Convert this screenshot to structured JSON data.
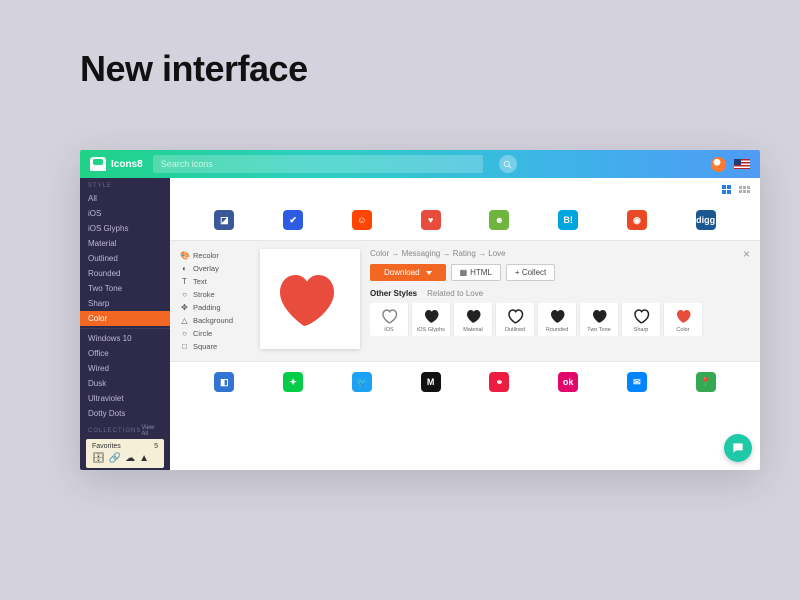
{
  "page": {
    "title": "New interface"
  },
  "header": {
    "brand": "Icons8",
    "search_placeholder": "Search icons"
  },
  "sidebar": {
    "style_header": "STYLE",
    "styles": [
      "All",
      "iOS",
      "iOS Glyphs",
      "Material",
      "Outlined",
      "Rounded",
      "Two Tone",
      "Sharp",
      "Color",
      "Windows 10",
      "Office",
      "Wired",
      "Dusk",
      "Ultraviolet",
      "Dotty Dots"
    ],
    "active_style_index": 8,
    "collections_header": "COLLECTIONS",
    "view_all": "View All",
    "favorites_label": "Favorites",
    "favorites_count": "5"
  },
  "view": {
    "modes": [
      "grid-large",
      "grid-small"
    ]
  },
  "top_row_icons": [
    "box-share",
    "foursquare-check",
    "reddit",
    "heart",
    "smugmug",
    "hatena",
    "stumbleupon",
    "digg"
  ],
  "detail": {
    "tools": [
      {
        "icon": "🎨",
        "label": "Recolor"
      },
      {
        "icon": "◐",
        "label": "Overlay"
      },
      {
        "icon": "T",
        "label": "Text"
      },
      {
        "icon": "○",
        "label": "Stroke"
      },
      {
        "icon": "✥",
        "label": "Padding"
      },
      {
        "icon": "△",
        "label": "Background"
      },
      {
        "icon": "○",
        "label": "Circle"
      },
      {
        "icon": "□",
        "label": "Square"
      }
    ],
    "breadcrumb": "Color → Messaging → Rating → Love",
    "download_label": "Download",
    "html_label": "HTML",
    "collect_label": "+ Collect",
    "other_styles_label": "Other Styles",
    "related_label": "Related to Love",
    "style_cards": [
      {
        "name": "iOS",
        "fill": "none",
        "stroke": "#888"
      },
      {
        "name": "iOS Glyphs",
        "fill": "#222",
        "stroke": "none"
      },
      {
        "name": "Material",
        "fill": "#222",
        "stroke": "none"
      },
      {
        "name": "Outlined",
        "fill": "none",
        "stroke": "#222"
      },
      {
        "name": "Rounded",
        "fill": "#222",
        "stroke": "none"
      },
      {
        "name": "Two Tone",
        "fill": "#222",
        "stroke": "none"
      },
      {
        "name": "Sharp",
        "fill": "none",
        "stroke": "#222"
      },
      {
        "name": "Color",
        "fill": "#e74c3c",
        "stroke": "none"
      }
    ]
  },
  "bottom_row_icons": [
    "delicious",
    "deviantart",
    "twitter",
    "medium",
    "meetup",
    "okcupid",
    "messenger",
    "google-maps"
  ],
  "colors": {
    "accent": "#f26722",
    "heart": "#e74c3c"
  }
}
